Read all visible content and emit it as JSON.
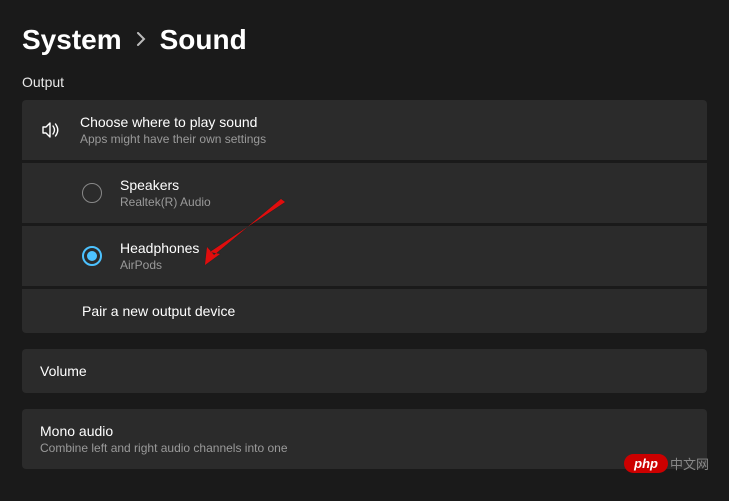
{
  "breadcrumb": {
    "parent": "System",
    "current": "Sound"
  },
  "section": {
    "output_label": "Output"
  },
  "output_header": {
    "title": "Choose where to play sound",
    "subtitle": "Apps might have their own settings"
  },
  "devices": [
    {
      "name": "Speakers",
      "detail": "Realtek(R) Audio",
      "selected": false
    },
    {
      "name": "Headphones",
      "detail": "AirPods",
      "selected": true
    }
  ],
  "pair_label": "Pair a new output device",
  "volume": {
    "title": "Volume"
  },
  "mono": {
    "title": "Mono audio",
    "subtitle": "Combine left and right audio channels into one"
  },
  "watermark": {
    "pill": "php",
    "rest": "中文网"
  }
}
